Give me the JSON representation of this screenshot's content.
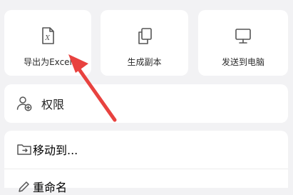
{
  "tiles": [
    {
      "label": "导出为Excel",
      "icon": "excel-file-icon"
    },
    {
      "label": "生成副本",
      "icon": "copy-icon"
    },
    {
      "label": "发送到电脑",
      "icon": "monitor-icon"
    }
  ],
  "rows": {
    "permission": {
      "label": "权限",
      "icon": "user-add-icon"
    },
    "move": {
      "label": "移动到...",
      "icon": "folder-move-icon"
    },
    "rename": {
      "label": "重命名",
      "icon": "edit-icon"
    }
  },
  "colors": {
    "background": "#f2f2f4",
    "card": "#ffffff",
    "icon": "#555555",
    "annotation_arrow": "#e8423f"
  }
}
